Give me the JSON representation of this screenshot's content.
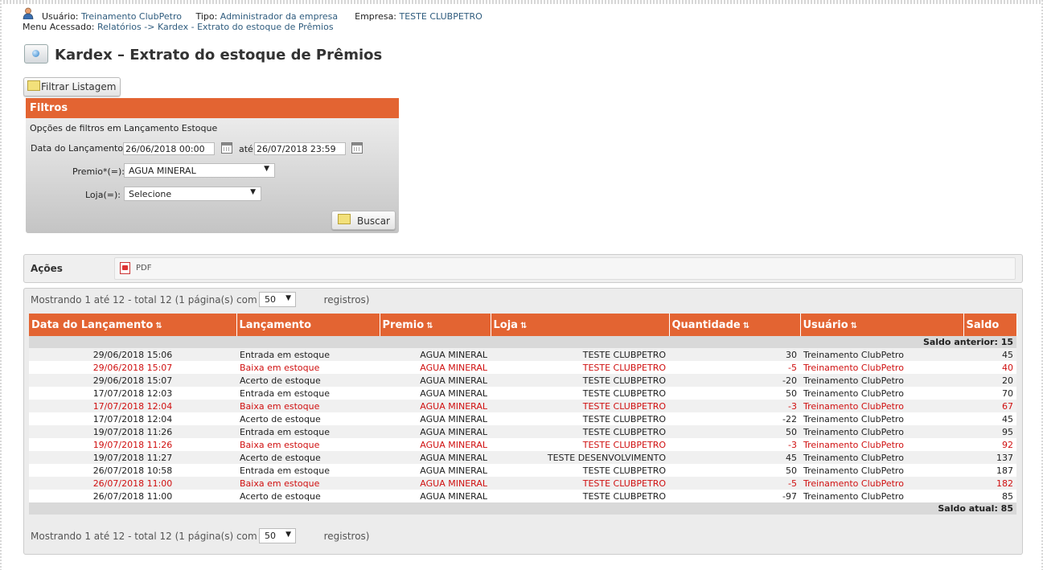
{
  "header": {
    "user_label": "Usuário:",
    "user_value": "Treinamento ClubPetro",
    "type_label": "Tipo:",
    "type_value": "Administrador da empresa",
    "company_label": "Empresa:",
    "company_value": "TESTE CLUBPETRO",
    "menu_label": "Menu Acessado:",
    "menu_value": "Relatórios -> Kardex - Extrato do estoque de Prêmios"
  },
  "page_title": "Kardex – Extrato do estoque de Prêmios",
  "filter_button": "Filtrar Listagem",
  "filters": {
    "title": "Filtros",
    "subtitle": "Opções de filtros em Lançamento Estoque",
    "date_label": "Data do Lançamento*:",
    "date_from": "26/06/2018 00:00",
    "ate_label": "até",
    "date_to": "26/07/2018 23:59",
    "premio_label": "Premio*(=):",
    "premio_value": "AGUA MINERAL",
    "loja_label": "Loja(=):",
    "loja_value": "Selecione",
    "search_button": "Buscar"
  },
  "actions": {
    "label": "Ações",
    "pdf_label": "PDF"
  },
  "paging": {
    "prefix": "Mostrando 1 até 12 - total 12 (1 página(s) com até",
    "per_page": "50",
    "suffix": "registros)"
  },
  "table": {
    "columns": [
      "Data do Lançamento",
      "Lançamento",
      "Premio",
      "Loja",
      "Quantidade",
      "Usuário",
      "Saldo"
    ],
    "saldo_anterior": "Saldo anterior: 15",
    "saldo_atual": "Saldo atual: 85",
    "rows": [
      [
        "29/06/2018 15:06",
        "Entrada em estoque",
        "AGUA MINERAL",
        "TESTE CLUBPETRO",
        "30",
        "Treinamento ClubPetro",
        "45"
      ],
      [
        "29/06/2018 15:07",
        "Baixa em estoque",
        "AGUA MINERAL",
        "TESTE CLUBPETRO",
        "-5",
        "Treinamento ClubPetro",
        "40"
      ],
      [
        "29/06/2018 15:07",
        "Acerto de estoque",
        "AGUA MINERAL",
        "TESTE CLUBPETRO",
        "-20",
        "Treinamento ClubPetro",
        "20"
      ],
      [
        "17/07/2018 12:03",
        "Entrada em estoque",
        "AGUA MINERAL",
        "TESTE CLUBPETRO",
        "50",
        "Treinamento ClubPetro",
        "70"
      ],
      [
        "17/07/2018 12:04",
        "Baixa em estoque",
        "AGUA MINERAL",
        "TESTE CLUBPETRO",
        "-3",
        "Treinamento ClubPetro",
        "67"
      ],
      [
        "17/07/2018 12:04",
        "Acerto de estoque",
        "AGUA MINERAL",
        "TESTE CLUBPETRO",
        "-22",
        "Treinamento ClubPetro",
        "45"
      ],
      [
        "19/07/2018 11:26",
        "Entrada em estoque",
        "AGUA MINERAL",
        "TESTE CLUBPETRO",
        "50",
        "Treinamento ClubPetro",
        "95"
      ],
      [
        "19/07/2018 11:26",
        "Baixa em estoque",
        "AGUA MINERAL",
        "TESTE CLUBPETRO",
        "-3",
        "Treinamento ClubPetro",
        "92"
      ],
      [
        "19/07/2018 11:27",
        "Acerto de estoque",
        "AGUA MINERAL",
        "TESTE DESENVOLVIMENTO",
        "45",
        "Treinamento ClubPetro",
        "137"
      ],
      [
        "26/07/2018 10:58",
        "Entrada em estoque",
        "AGUA MINERAL",
        "TESTE CLUBPETRO",
        "50",
        "Treinamento ClubPetro",
        "187"
      ],
      [
        "26/07/2018 11:00",
        "Baixa em estoque",
        "AGUA MINERAL",
        "TESTE CLUBPETRO",
        "-5",
        "Treinamento ClubPetro",
        "182"
      ],
      [
        "26/07/2018 11:00",
        "Acerto de estoque",
        "AGUA MINERAL",
        "TESTE CLUBPETRO",
        "-97",
        "Treinamento ClubPetro",
        "85"
      ]
    ]
  },
  "colors": {
    "accent": "#e36432",
    "link": "#2f5c7e",
    "negative_row": "#d01010"
  }
}
